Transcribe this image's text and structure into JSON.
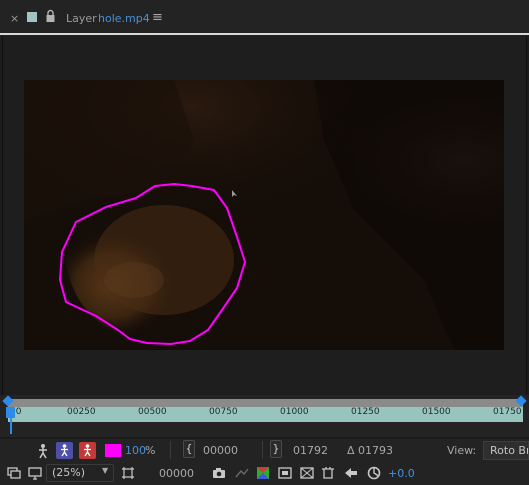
{
  "tab": {
    "close_glyph": "×",
    "layer_label": "Layer",
    "file_name": "hole.mp4",
    "menu_glyph": "≡"
  },
  "viewer": {
    "mask_color": "#ff00ff",
    "background": "#1e1e1e"
  },
  "timeline": {
    "ticks": [
      "00",
      "00250",
      "00500",
      "00750",
      "01000",
      "01250",
      "01500",
      "01750"
    ],
    "ruler_color": "#98c4be",
    "pointer_color": "#2d8ceb"
  },
  "roto": {
    "opacity_value": "100",
    "opacity_unit": "%",
    "in_time": "00000",
    "out_time": "01792",
    "duration": "Δ 01793",
    "view_label": "View:",
    "view_value": "Roto Br"
  },
  "bottom_bar": {
    "zoom": "(25%)",
    "current_time": "00000",
    "exposure": "+0.0"
  },
  "icons": {
    "always_preview": "always-preview-icon",
    "monitor": "monitor-icon",
    "region": "region-of-interest-icon",
    "snapshot": "camera-icon",
    "show_snapshot": "show-snapshot-icon",
    "channels": "rgb-channels-icon",
    "transparency": "transparency-grid-icon",
    "fast_preview": "fast-preview-icon",
    "flowchart": "flowchart-icon",
    "reset_exposure": "reset-exposure-icon"
  }
}
